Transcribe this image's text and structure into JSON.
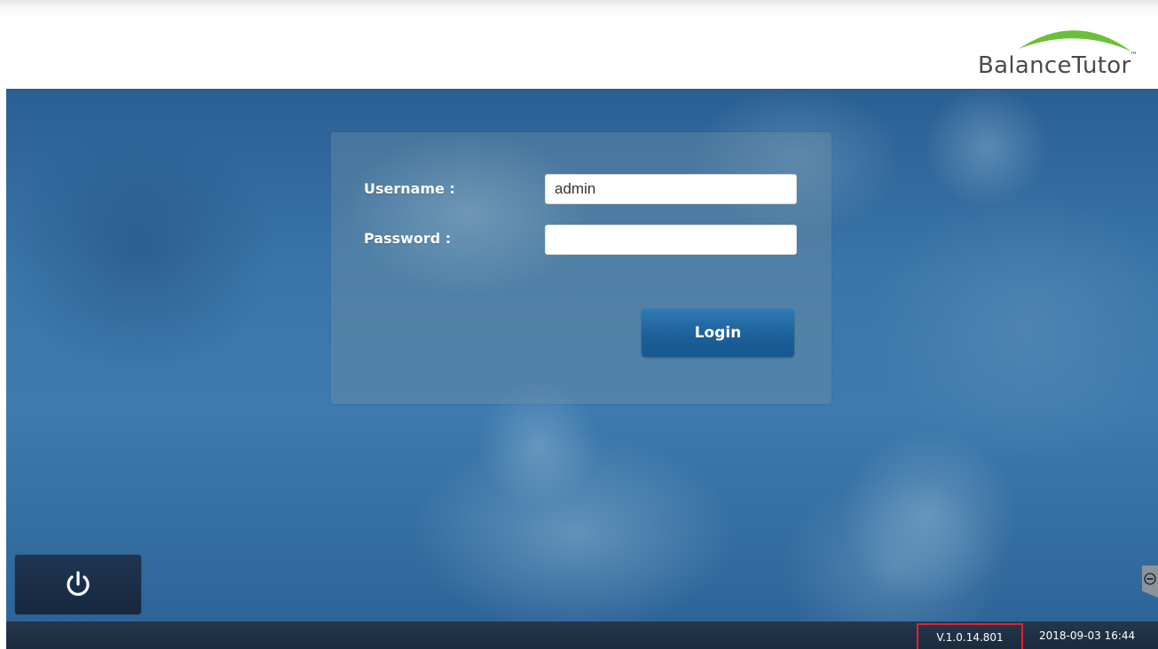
{
  "brand": {
    "name": "BalanceTutor",
    "trademark": "™",
    "swoosh_color": "#6cbf3a"
  },
  "login": {
    "username_label": "Username :",
    "username_value": "admin",
    "password_label": "Password :",
    "password_value": "",
    "button_label": "Login"
  },
  "colors": {
    "background_blue": "#3b76a8",
    "button_blue": "#1c609b",
    "status_bar": "#1b2a3d",
    "highlight_border": "#e8202a"
  },
  "controls": {
    "power_icon": "power-icon",
    "side_tab_icon": "minus-circle-icon"
  },
  "status": {
    "version": "V.1.0.14.801",
    "datetime": "2018-09-03 16:44"
  }
}
